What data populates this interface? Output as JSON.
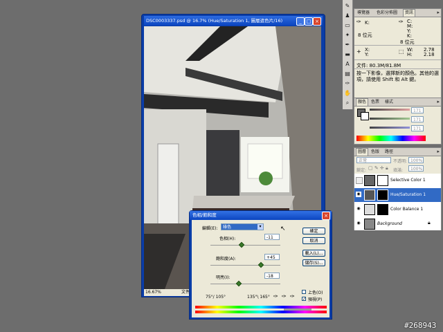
{
  "document": {
    "title": "DSC0003337.psd @ 16.7% (Hue/Saturation 1, 圖層遮色片/16)",
    "zoom": "16.67%",
    "status_label": "文件:"
  },
  "info_panel": {
    "tabs": [
      "導覽器",
      "色彩分佈圖",
      "資訊"
    ],
    "active_tab": "資訊",
    "rows": {
      "k_label": "K:",
      "c_label": "C:",
      "m_label": "M:",
      "y_label": "Y:",
      "k2_label": "K:",
      "bits_left": "8 位元",
      "bits_right": "8 位元",
      "x_label": "X:",
      "x_value": "",
      "y2_label": "Y:",
      "y2_value": "",
      "w_label": "W:",
      "w_value": "2.78",
      "h_label": "H:",
      "h_value": "2.18"
    },
    "doc_size": "文件: 80.3M/81.8M",
    "hint": "按一下影像，選擇新的顏色。其他的選項，請使用 Shift 和 Alt 鍵。"
  },
  "color_panel": {
    "tabs": [
      "顏色",
      "色票",
      "樣式"
    ],
    "active_tab": "顏色",
    "sliders": [
      {
        "value": "171",
        "color": "#c07070"
      },
      {
        "value": "171",
        "color": "#80a070"
      },
      {
        "value": "171",
        "color": "#7070c0"
      }
    ]
  },
  "layers_panel": {
    "tabs": [
      "圖層",
      "色版",
      "路徑"
    ],
    "active_tab": "圖層",
    "blend_mode": "正常",
    "opacity_label": "不透明:",
    "opacity_value": "100%",
    "lock_label": "鎖定:",
    "fill_label": "填滿:",
    "fill_value": "100%",
    "layers": [
      {
        "name": "Selective Color 1",
        "selected": false,
        "visible": false
      },
      {
        "name": "Hue/Saturation 1",
        "selected": true,
        "visible": true
      },
      {
        "name": "Color Balance 1",
        "selected": false,
        "visible": true
      },
      {
        "name": "Background",
        "selected": false,
        "visible": true
      }
    ]
  },
  "hue_sat_dialog": {
    "title": "色相/飽和度",
    "edit_label": "編輯(E):",
    "edit_value": "綠色",
    "hue_label": "色相(H):",
    "hue_value": "-11",
    "hue_level": 0.45,
    "sat_label": "飽和度(A):",
    "sat_value": "+45",
    "sat_level": 0.72,
    "light_label": "明亮(I):",
    "light_value": "-18",
    "light_level": 0.41,
    "ok": "確定",
    "cancel": "取消",
    "load": "載入(L)...",
    "save": "儲存(S)...",
    "range_left": "75°/ 105°",
    "range_right": "135°\\ 165°",
    "colorize_label": "上色(O)",
    "preview_label": "預視(P)",
    "preview_checked": true
  },
  "watermark": "#268943"
}
